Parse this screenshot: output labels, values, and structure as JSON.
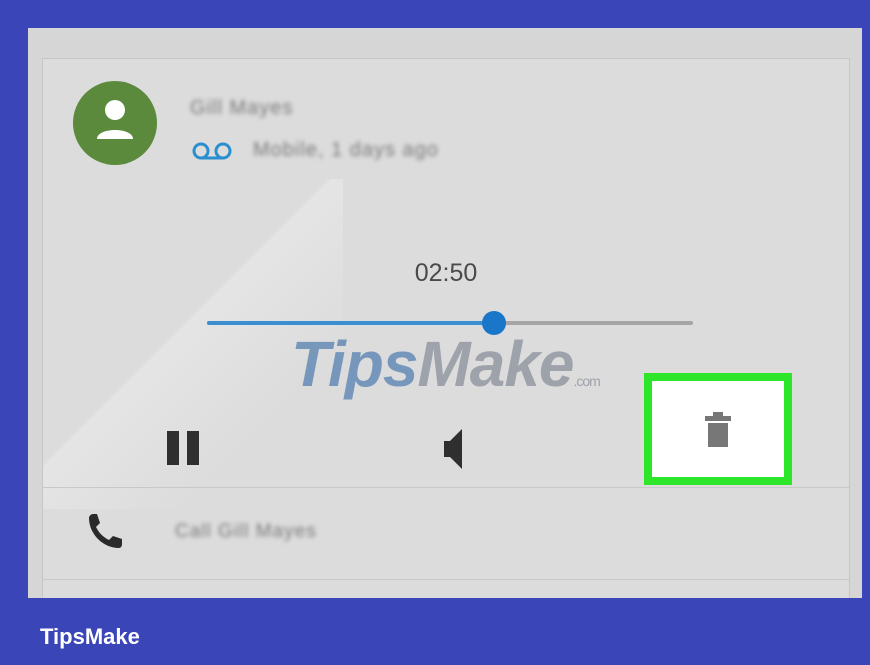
{
  "contact": {
    "name": "Gill Mayes",
    "avatar_color": "#5b8a3c",
    "voicemail_icon": "voicemail-icon",
    "detail": "Mobile, 1 days ago"
  },
  "player": {
    "timestamp": "02:50",
    "progress": 0.59,
    "accent_color": "#1976c9",
    "pause_icon": "pause-icon",
    "speaker_icon": "speaker-icon",
    "delete_icon": "trash-icon"
  },
  "highlight_color": "#2ee629",
  "call_row": {
    "icon": "phone-icon",
    "label": "Call Gill Mayes"
  },
  "watermark": {
    "part1": "T",
    "part2": "ips",
    "part3": "Make",
    "suffix": ".com"
  },
  "brand": "TipsMake"
}
